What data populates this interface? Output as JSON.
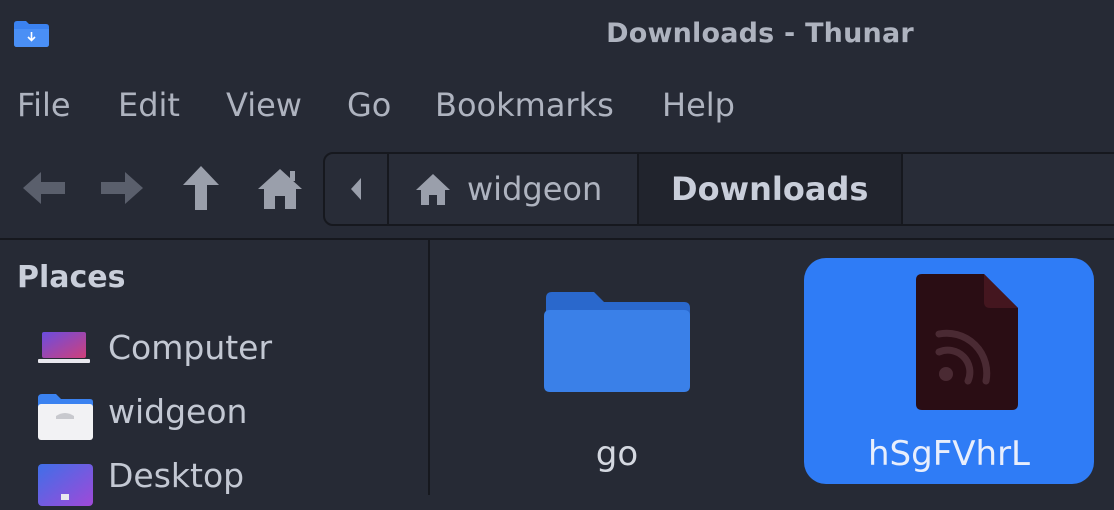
{
  "window": {
    "title": "Downloads - Thunar"
  },
  "menubar": {
    "items": [
      "File",
      "Edit",
      "View",
      "Go",
      "Bookmarks",
      "Help"
    ]
  },
  "pathbar": {
    "segments": [
      {
        "label": "widgeon",
        "icon": "home-icon"
      },
      {
        "label": "Downloads",
        "icon": ""
      }
    ]
  },
  "sidebar": {
    "title": "Places",
    "items": [
      {
        "label": "Computer",
        "icon": "computer-icon"
      },
      {
        "label": "widgeon",
        "icon": "home-folder-icon"
      },
      {
        "label": "Desktop",
        "icon": "desktop-icon"
      }
    ]
  },
  "files": [
    {
      "name": "go",
      "icon": "folder-icon",
      "selected": false
    },
    {
      "name": "hSgFVhrL",
      "icon": "rss-file-icon",
      "selected": true
    }
  ],
  "colors": {
    "background": "#262a35",
    "accent": "#2f7cf6",
    "folder": "#3a80e8"
  }
}
